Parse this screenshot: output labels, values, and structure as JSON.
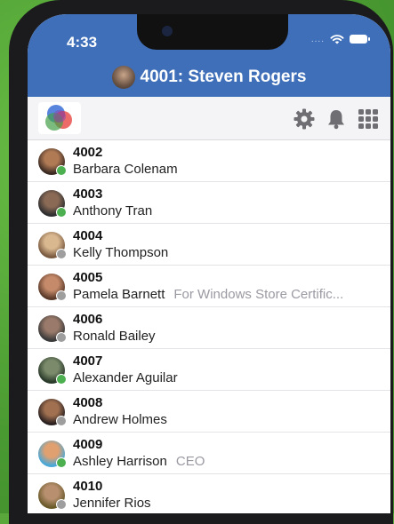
{
  "status_bar": {
    "time": "4:33",
    "dots": "...."
  },
  "header": {
    "title": "4001: Steven Rogers"
  },
  "toolbar": {
    "icons": [
      "gear-icon",
      "bell-icon",
      "dialpad-icon"
    ]
  },
  "contacts": [
    {
      "ext": "4002",
      "name": "Barbara Colenam",
      "note": "",
      "presence": "online"
    },
    {
      "ext": "4003",
      "name": "Anthony Tran",
      "note": "",
      "presence": "online"
    },
    {
      "ext": "4004",
      "name": "Kelly Thompson",
      "note": "",
      "presence": "offline"
    },
    {
      "ext": "4005",
      "name": "Pamela Barnett",
      "note": "For Windows Store Certific...",
      "presence": "offline"
    },
    {
      "ext": "4006",
      "name": "Ronald Bailey",
      "note": "",
      "presence": "offline"
    },
    {
      "ext": "4007",
      "name": "Alexander Aguilar",
      "note": "",
      "presence": "online"
    },
    {
      "ext": "4008",
      "name": "Andrew Holmes",
      "note": "",
      "presence": "offline"
    },
    {
      "ext": "4009",
      "name": "Ashley Harrison",
      "note": "CEO",
      "presence": "online"
    },
    {
      "ext": "4010",
      "name": "Jennifer Rios",
      "note": "",
      "presence": "offline"
    }
  ],
  "colors": {
    "header": "#3f6fb9",
    "online": "#4caf50",
    "offline": "#9e9e9e",
    "background": "#5aa83c"
  }
}
